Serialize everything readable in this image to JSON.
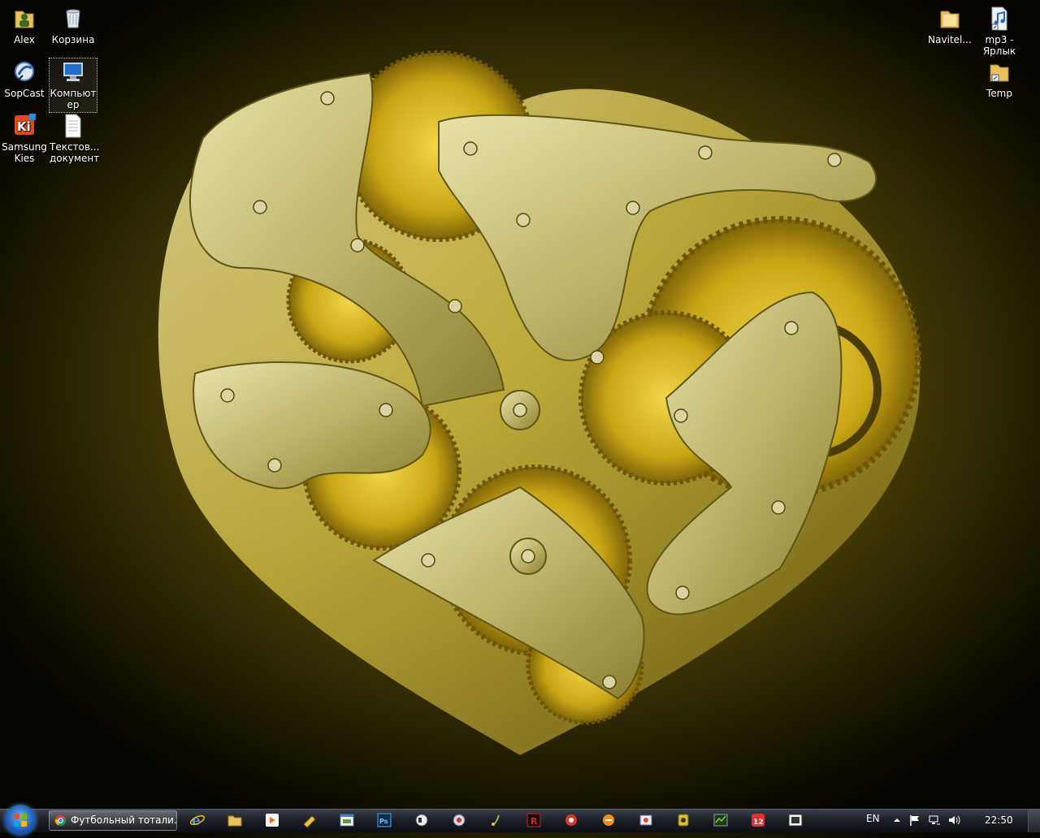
{
  "desktop": {
    "icons": [
      {
        "label": "Alex",
        "icon": "user-folder-icon"
      },
      {
        "label": "Корзина",
        "icon": "recycle-bin-icon"
      },
      {
        "label": "SopCast",
        "icon": "sopcast-icon"
      },
      {
        "label": "Компьют ер",
        "icon": "computer-icon"
      },
      {
        "label": "Samsung Kies",
        "icon": "samsung-kies-icon"
      },
      {
        "label": "Текстов... документ",
        "icon": "text-document-icon"
      },
      {
        "label": "Navitel...",
        "icon": "folder-icon"
      },
      {
        "label": "mp3 - Ярлык",
        "icon": "audio-shortcut-icon"
      },
      {
        "label": "Temp",
        "icon": "folder-shortcut-icon"
      }
    ]
  },
  "taskbar": {
    "active_window_label": "Футбольный тотали...",
    "pinned": [
      "internet-explorer-icon",
      "explorer-icon",
      "media-player-icon",
      "app-icon",
      "window-app-icon",
      "photoshop-icon",
      "app-icon",
      "app-icon",
      "app-icon",
      "app-icon",
      "r-app-icon",
      "app-icon",
      "app-icon",
      "app-icon",
      "app-icon",
      "app-icon",
      "app-icon",
      "app-icon"
    ],
    "language": "EN",
    "clock": "22:50"
  },
  "colors": {
    "wallpaper_dark": "#050400",
    "wallpaper_gold": "#c9b540",
    "taskbar": "#1d2027"
  }
}
